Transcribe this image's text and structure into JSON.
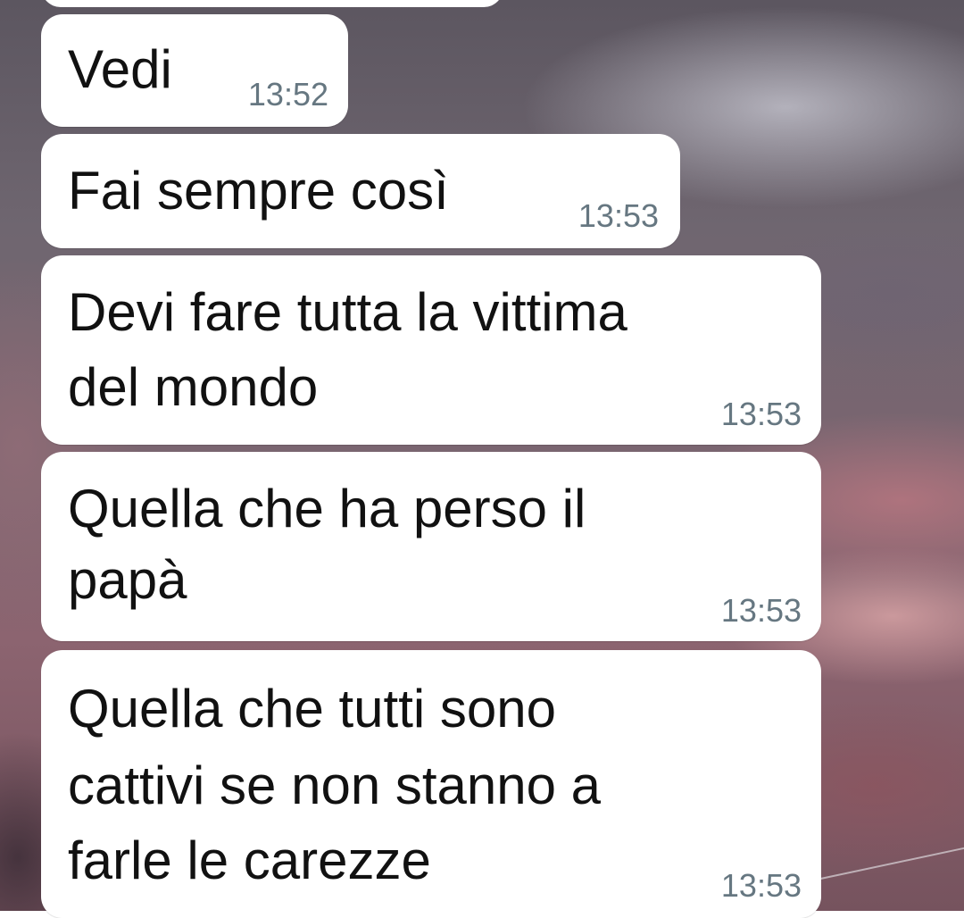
{
  "messages": [
    {
      "lines": [
        "Vedi"
      ],
      "time": "13:52"
    },
    {
      "lines": [
        "Fai sempre così"
      ],
      "time": "13:53"
    },
    {
      "lines": [
        "Devi fare tutta la vittima",
        "del mondo"
      ],
      "time": "13:53"
    },
    {
      "lines": [
        "Quella che ha perso il",
        "papà"
      ],
      "time": "13:53"
    },
    {
      "lines": [
        "Quella che tutti sono",
        "cattivi se non stanno a",
        "farle le carezze"
      ],
      "time": "13:53"
    }
  ]
}
